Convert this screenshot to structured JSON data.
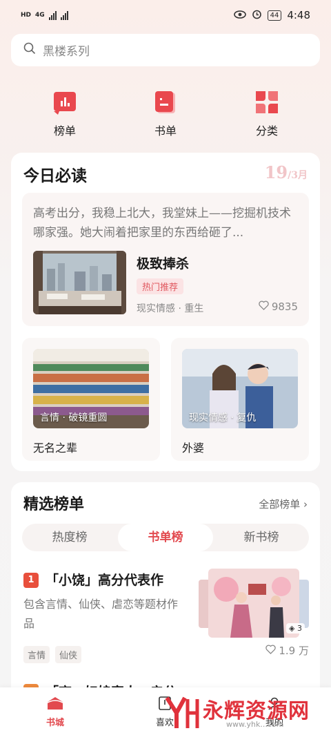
{
  "status_bar": {
    "left_text_1": "HD",
    "left_text_2": "4G",
    "time": "4:48",
    "battery": "44"
  },
  "search": {
    "placeholder": "黑楼系列",
    "icon": "search-icon"
  },
  "quick_nav": [
    {
      "label": "榜单",
      "icon": "chart-bars-icon"
    },
    {
      "label": "书单",
      "icon": "book-list-icon"
    },
    {
      "label": "分类",
      "icon": "category-grid-icon"
    }
  ],
  "today": {
    "title": "今日必读",
    "date_day": "19",
    "date_month": "/3月",
    "feature": {
      "excerpt": "高考出分，我稳上北大，我堂妹上——挖掘机技术哪家强。她大闹着把家里的东西给砸了...",
      "book_name": "极致捧杀",
      "tag": "热门推荐",
      "genre": "现实情感 · 重生",
      "likes": "9835"
    },
    "minis": [
      {
        "genre": "言情 · 破镜重圆",
        "name": "无名之辈"
      },
      {
        "genre": "现实情感 · 复仇",
        "name": "外婆"
      }
    ]
  },
  "ranking": {
    "title": "精选榜单",
    "all_label": "全部榜单",
    "tabs": [
      "热度榜",
      "书单榜",
      "新书榜"
    ],
    "active_tab": "书单榜",
    "item1": {
      "number": "1",
      "title": "「小饶」高分代表作",
      "desc": "包含言情、仙侠、虐恋等题材作品",
      "tags": [
        "言情",
        "仙侠"
      ],
      "likes": "1.9 万",
      "cover_count": "3"
    },
    "item2": {
      "title": "「商…妇娘家人…亲分"
    }
  },
  "bottom_nav": [
    {
      "label": "书城",
      "icon": "bookstore-icon",
      "active": true
    },
    {
      "label": "喜欢",
      "icon": "like-icon",
      "active": false
    },
    {
      "label": "我的",
      "icon": "profile-icon",
      "active": false
    }
  ],
  "watermark": {
    "text": "永辉资源网",
    "url": "www.yhk...com"
  },
  "colors": {
    "accent": "#e2494e",
    "tag_bg": "#fbe3e4",
    "date": "#f1c5c8"
  }
}
